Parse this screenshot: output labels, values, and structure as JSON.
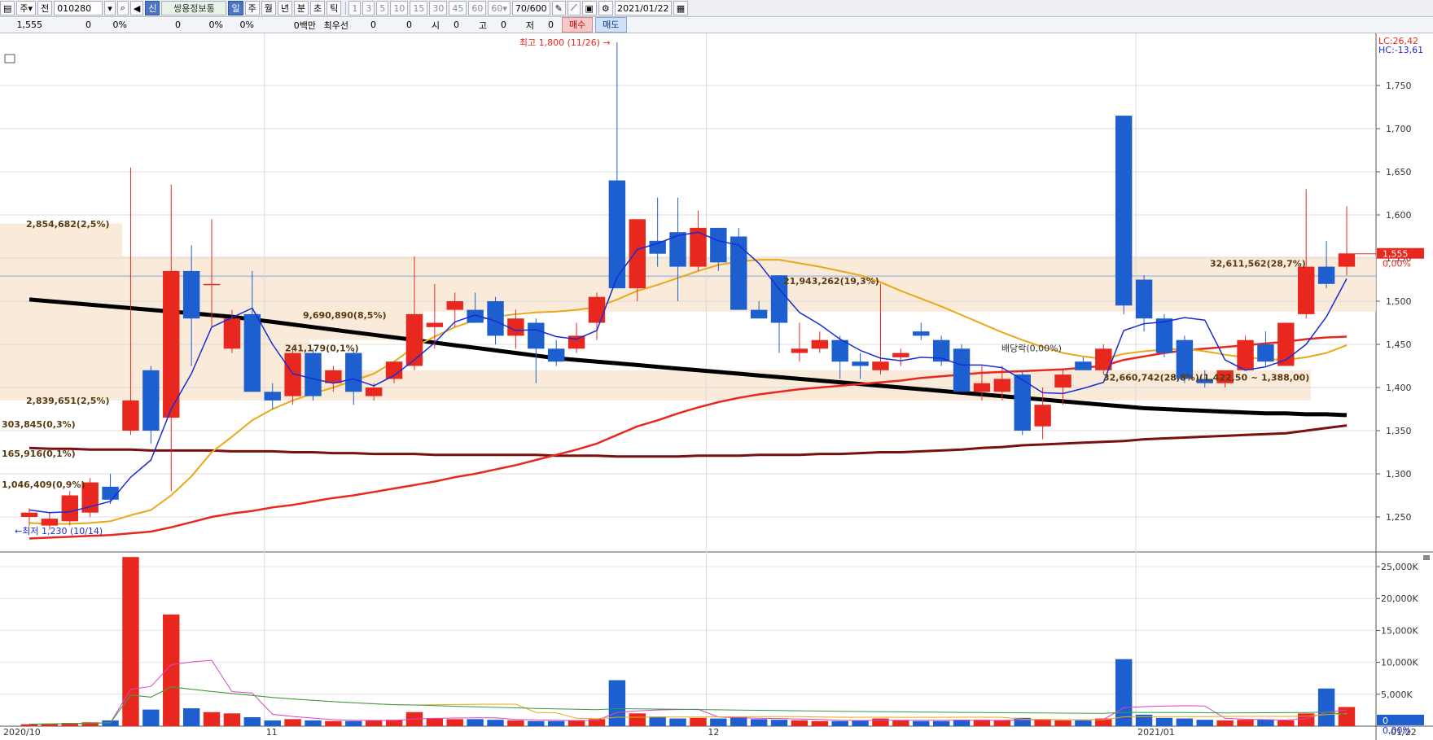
{
  "toolbar": {
    "type_btn": "주",
    "jeon": "전",
    "code": "010280",
    "sin": "신",
    "stock_name": "쌍용정보통",
    "periods": [
      "일",
      "주",
      "월",
      "년",
      "분",
      "초",
      "틱"
    ],
    "active_period": "일",
    "intervals": [
      "1",
      "3",
      "5",
      "10",
      "15",
      "30",
      "45",
      "60"
    ],
    "interval_value": "60",
    "count": "70",
    "count_total": "/600",
    "date": "2021/01/22"
  },
  "infobar": {
    "price": "1,555",
    "change": "0",
    "change_pct": "0%",
    "volume": "0",
    "vol_pct": "0%",
    "vol_pct2": "0%",
    "amount": "0백만",
    "priority_label": "최우선",
    "bid": "0",
    "ask": "0",
    "open_label": "시",
    "open": "0",
    "high_label": "고",
    "high": "0",
    "low_label": "저",
    "low": "0",
    "buy_label": "매수",
    "sell_label": "매도"
  },
  "colors": {
    "up": "#e8281e",
    "down": "#1d5fcf",
    "ma5": "#1a2bd6",
    "ma20": "#e8a817",
    "ma60": "#e8281e",
    "ma120": "#000000",
    "ma240": "#7a1010",
    "profile": "#f8e6d2"
  },
  "chart_data": [
    {
      "type": "candlestick",
      "x_labels": [
        "2020/10",
        "11",
        "12",
        "2021/01",
        "01/22"
      ],
      "ylim": [
        1200,
        1800
      ],
      "y_ticks": [
        "1,250",
        "1,300",
        "1,350",
        "1,400",
        "1,450",
        "1,500",
        "1,550",
        "1,600",
        "1,650",
        "1,700",
        "1,750"
      ],
      "candles": [
        {
          "o": 1250,
          "h": 1260,
          "l": 1240,
          "c": 1255
        },
        {
          "o": 1240,
          "h": 1255,
          "l": 1235,
          "c": 1248
        },
        {
          "o": 1245,
          "h": 1280,
          "l": 1240,
          "c": 1275
        },
        {
          "o": 1255,
          "h": 1295,
          "l": 1250,
          "c": 1290
        },
        {
          "o": 1285,
          "h": 1300,
          "l": 1265,
          "c": 1270
        },
        {
          "o": 1350,
          "h": 1655,
          "l": 1345,
          "c": 1385
        },
        {
          "o": 1420,
          "h": 1425,
          "l": 1335,
          "c": 1350
        },
        {
          "o": 1365,
          "h": 1635,
          "l": 1280,
          "c": 1535
        },
        {
          "o": 1535,
          "h": 1565,
          "l": 1425,
          "c": 1480
        },
        {
          "o": 1520,
          "h": 1595,
          "l": 1470,
          "c": 1520
        },
        {
          "o": 1445,
          "h": 1490,
          "l": 1440,
          "c": 1480
        },
        {
          "o": 1485,
          "h": 1535,
          "l": 1395,
          "c": 1395
        },
        {
          "o": 1395,
          "h": 1405,
          "l": 1375,
          "c": 1385
        },
        {
          "o": 1390,
          "h": 1445,
          "l": 1380,
          "c": 1440
        },
        {
          "o": 1440,
          "h": 1445,
          "l": 1385,
          "c": 1390
        },
        {
          "o": 1405,
          "h": 1425,
          "l": 1395,
          "c": 1420
        },
        {
          "o": 1440,
          "h": 1445,
          "l": 1380,
          "c": 1395
        },
        {
          "o": 1390,
          "h": 1405,
          "l": 1385,
          "c": 1400
        },
        {
          "o": 1410,
          "h": 1430,
          "l": 1405,
          "c": 1430
        },
        {
          "o": 1425,
          "h": 1552,
          "l": 1420,
          "c": 1485
        },
        {
          "o": 1470,
          "h": 1520,
          "l": 1445,
          "c": 1475
        },
        {
          "o": 1490,
          "h": 1510,
          "l": 1470,
          "c": 1500
        },
        {
          "o": 1490,
          "h": 1510,
          "l": 1480,
          "c": 1475
        },
        {
          "o": 1500,
          "h": 1505,
          "l": 1450,
          "c": 1460
        },
        {
          "o": 1460,
          "h": 1490,
          "l": 1445,
          "c": 1480
        },
        {
          "o": 1475,
          "h": 1480,
          "l": 1405,
          "c": 1445
        },
        {
          "o": 1445,
          "h": 1455,
          "l": 1425,
          "c": 1430
        },
        {
          "o": 1445,
          "h": 1475,
          "l": 1440,
          "c": 1460
        },
        {
          "o": 1475,
          "h": 1510,
          "l": 1455,
          "c": 1505
        },
        {
          "o": 1640,
          "h": 1800,
          "l": 1520,
          "c": 1515
        },
        {
          "o": 1515,
          "h": 1595,
          "l": 1500,
          "c": 1595
        },
        {
          "o": 1570,
          "h": 1620,
          "l": 1540,
          "c": 1555
        },
        {
          "o": 1580,
          "h": 1620,
          "l": 1500,
          "c": 1540
        },
        {
          "o": 1540,
          "h": 1605,
          "l": 1535,
          "c": 1585
        },
        {
          "o": 1585,
          "h": 1585,
          "l": 1535,
          "c": 1545
        },
        {
          "o": 1575,
          "h": 1585,
          "l": 1490,
          "c": 1490
        },
        {
          "o": 1490,
          "h": 1500,
          "l": 1480,
          "c": 1480
        },
        {
          "o": 1530,
          "h": 1530,
          "l": 1440,
          "c": 1475
        },
        {
          "o": 1440,
          "h": 1475,
          "l": 1430,
          "c": 1445
        },
        {
          "o": 1445,
          "h": 1465,
          "l": 1440,
          "c": 1455
        },
        {
          "o": 1455,
          "h": 1460,
          "l": 1410,
          "c": 1430
        },
        {
          "o": 1430,
          "h": 1440,
          "l": 1410,
          "c": 1425
        },
        {
          "o": 1420,
          "h": 1520,
          "l": 1415,
          "c": 1430
        },
        {
          "o": 1435,
          "h": 1445,
          "l": 1425,
          "c": 1440
        },
        {
          "o": 1465,
          "h": 1475,
          "l": 1455,
          "c": 1460
        },
        {
          "o": 1455,
          "h": 1460,
          "l": 1425,
          "c": 1430
        },
        {
          "o": 1445,
          "h": 1450,
          "l": 1395,
          "c": 1395
        },
        {
          "o": 1395,
          "h": 1425,
          "l": 1385,
          "c": 1405
        },
        {
          "o": 1395,
          "h": 1425,
          "l": 1385,
          "c": 1410
        },
        {
          "o": 1415,
          "h": 1420,
          "l": 1345,
          "c": 1350
        },
        {
          "o": 1355,
          "h": 1400,
          "l": 1340,
          "c": 1380
        },
        {
          "o": 1400,
          "h": 1420,
          "l": 1380,
          "c": 1415
        },
        {
          "o": 1430,
          "h": 1435,
          "l": 1420,
          "c": 1420
        },
        {
          "o": 1420,
          "h": 1450,
          "l": 1415,
          "c": 1445
        },
        {
          "o": 1715,
          "h": 1715,
          "l": 1485,
          "c": 1495
        },
        {
          "o": 1525,
          "h": 1530,
          "l": 1465,
          "c": 1480
        },
        {
          "o": 1480,
          "h": 1485,
          "l": 1435,
          "c": 1440
        },
        {
          "o": 1455,
          "h": 1460,
          "l": 1405,
          "c": 1410
        },
        {
          "o": 1410,
          "h": 1420,
          "l": 1400,
          "c": 1405
        },
        {
          "o": 1405,
          "h": 1420,
          "l": 1400,
          "c": 1420
        },
        {
          "o": 1420,
          "h": 1460,
          "l": 1420,
          "c": 1455
        },
        {
          "o": 1450,
          "h": 1465,
          "l": 1425,
          "c": 1430
        },
        {
          "o": 1425,
          "h": 1475,
          "l": 1425,
          "c": 1475
        },
        {
          "o": 1485,
          "h": 1630,
          "l": 1480,
          "c": 1540
        },
        {
          "o": 1540,
          "h": 1570,
          "l": 1515,
          "c": 1520
        },
        {
          "o": 1540,
          "h": 1610,
          "l": 1530,
          "c": 1555
        }
      ],
      "ma5": [
        1258,
        1255,
        1256,
        1262,
        1268,
        1296,
        1316,
        1375,
        1416,
        1470,
        1481,
        1492,
        1450,
        1416,
        1410,
        1405,
        1410,
        1402,
        1414,
        1432,
        1452,
        1476,
        1484,
        1477,
        1466,
        1467,
        1459,
        1456,
        1466,
        1528,
        1560,
        1567,
        1576,
        1580,
        1570,
        1565,
        1544,
        1514,
        1487,
        1473,
        1456,
        1443,
        1434,
        1431,
        1435,
        1434,
        1426,
        1426,
        1423,
        1409,
        1394,
        1393,
        1399,
        1406,
        1466,
        1474,
        1476,
        1481,
        1478,
        1432,
        1420,
        1424,
        1432,
        1450,
        1482,
        1526
      ],
      "ma20": [
        1243,
        1242,
        1242,
        1243,
        1245,
        1252,
        1258,
        1275,
        1297,
        1325,
        1343,
        1362,
        1375,
        1385,
        1393,
        1400,
        1408,
        1416,
        1430,
        1447,
        1459,
        1470,
        1478,
        1482,
        1485,
        1487,
        1488,
        1490,
        1493,
        1502,
        1512,
        1519,
        1527,
        1535,
        1542,
        1546,
        1548,
        1548,
        1544,
        1540,
        1535,
        1530,
        1522,
        1512,
        1503,
        1494,
        1484,
        1474,
        1464,
        1455,
        1447,
        1440,
        1436,
        1433,
        1439,
        1442,
        1444,
        1445,
        1442,
        1438,
        1435,
        1433,
        1432,
        1435,
        1440,
        1449
      ],
      "ma60": [
        1225,
        1226,
        1227,
        1228,
        1229,
        1231,
        1233,
        1238,
        1244,
        1250,
        1254,
        1257,
        1261,
        1264,
        1268,
        1272,
        1275,
        1279,
        1283,
        1287,
        1291,
        1296,
        1300,
        1305,
        1310,
        1316,
        1322,
        1328,
        1335,
        1345,
        1355,
        1362,
        1370,
        1377,
        1383,
        1388,
        1392,
        1395,
        1398,
        1400,
        1402,
        1404,
        1406,
        1408,
        1411,
        1413,
        1415,
        1417,
        1418,
        1419,
        1420,
        1421,
        1423,
        1425,
        1432,
        1436,
        1440,
        1443,
        1445,
        1447,
        1449,
        1451,
        1453,
        1456,
        1458,
        1459
      ],
      "ma120": [
        1502,
        1500,
        1498,
        1496,
        1494,
        1492,
        1490,
        1488,
        1486,
        1484,
        1482,
        1479,
        1476,
        1473,
        1470,
        1467,
        1464,
        1461,
        1458,
        1455,
        1452,
        1449,
        1446,
        1443,
        1440,
        1437,
        1434,
        1432,
        1430,
        1428,
        1426,
        1424,
        1422,
        1420,
        1418,
        1416,
        1414,
        1412,
        1410,
        1408,
        1406,
        1404,
        1402,
        1400,
        1398,
        1396,
        1394,
        1392,
        1390,
        1388,
        1386,
        1384,
        1382,
        1380,
        1378,
        1376,
        1375,
        1374,
        1373,
        1372,
        1371,
        1370,
        1370,
        1369,
        1369,
        1368
      ],
      "ma240": [
        1330,
        1329,
        1329,
        1328,
        1328,
        1328,
        1327,
        1327,
        1327,
        1327,
        1326,
        1326,
        1326,
        1325,
        1325,
        1324,
        1324,
        1323,
        1323,
        1323,
        1322,
        1322,
        1322,
        1322,
        1322,
        1322,
        1321,
        1321,
        1321,
        1320,
        1320,
        1320,
        1320,
        1321,
        1321,
        1321,
        1322,
        1322,
        1322,
        1323,
        1323,
        1324,
        1325,
        1325,
        1326,
        1327,
        1328,
        1330,
        1331,
        1333,
        1334,
        1335,
        1336,
        1337,
        1338,
        1340,
        1341,
        1342,
        1343,
        1344,
        1345,
        1346,
        1347,
        1350,
        1353,
        1356
      ],
      "annotations": {
        "high": "최고 1,800 (11/26)",
        "low": "최저 1,230 (10/14)",
        "dividend": "배당락(0,00%)",
        "current_price": "1,555",
        "current_pct": "0,00%",
        "lc": "LC:26,42",
        "hc": "HC:-13,61",
        "profile_labels": [
          "2,854,682(2,5%)",
          "2,839,651(2,5%)",
          "303,845(0,3%)",
          "165,916(0,1%)",
          "1,046,409(0,9%)",
          "9,690,890(8,5%)",
          "241,179(0,1%)",
          "21,943,262(19,3%)",
          "32,660,742(28,8%)(1,422,50 ~ 1,388,00)",
          "32,611,562(28,7%)"
        ]
      }
    },
    {
      "type": "bar",
      "title": "volume",
      "ylim": [
        0,
        27000
      ],
      "y_ticks": [
        "5,000K",
        "10,000K",
        "15,000K",
        "20,000K",
        "25,000K"
      ],
      "current_volume": "0",
      "current_volume_pct": "0,00%",
      "volumes": [
        300,
        400,
        500,
        600,
        900,
        26500,
        2600,
        17500,
        2800,
        2200,
        2000,
        1400,
        900,
        1100,
        900,
        800,
        800,
        900,
        1000,
        2200,
        1200,
        1100,
        1100,
        1000,
        900,
        800,
        800,
        900,
        1100,
        7200,
        2000,
        1500,
        1200,
        1300,
        1200,
        1400,
        1100,
        1000,
        900,
        800,
        800,
        900,
        1200,
        900,
        800,
        800,
        1000,
        1000,
        900,
        1300,
        1000,
        900,
        900,
        1200,
        10500,
        1800,
        1300,
        1200,
        1000,
        900,
        1000,
        1000,
        900,
        2000,
        5900,
        3000
      ]
    }
  ]
}
